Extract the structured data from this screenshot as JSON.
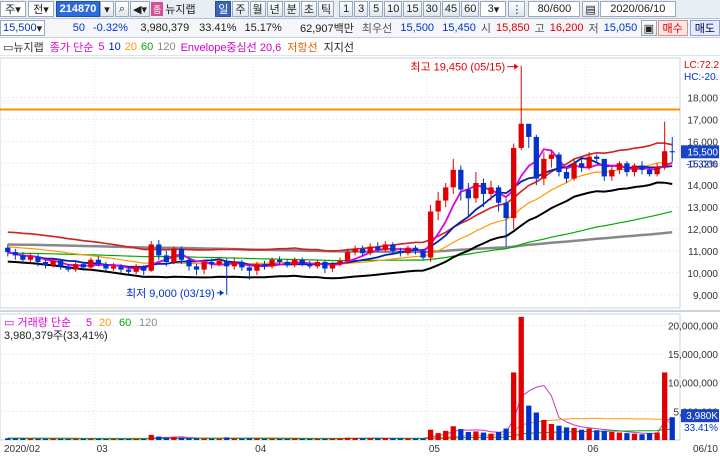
{
  "toolbar": {
    "menu1": "주",
    "menu2": "전",
    "stock_code": "214870",
    "news_label": "뉴지랩",
    "periods": [
      "일",
      "주",
      "월",
      "년",
      "분",
      "초",
      "틱"
    ],
    "selected_period": "일",
    "intervals": [
      "1",
      "3",
      "5",
      "10",
      "15",
      "30",
      "45",
      "60"
    ],
    "interval_value": "3",
    "count": "80/600",
    "date": "2020/06/10"
  },
  "quote": {
    "price": "15,500",
    "change": "50",
    "change_rate": "-0.32%",
    "volume": "3,980,379",
    "turnover_rate": "33.41%",
    "rate2": "15.17%",
    "amount": "62,907백만",
    "best_ask_label": "최우선",
    "best_ask": "15,500",
    "best_bid": "15,450",
    "open_label": "시",
    "open": "15,850",
    "high_label": "고",
    "high": "16,200",
    "low_label": "저",
    "low": "15,050",
    "buy_label": "매수",
    "sell_label": "매도"
  },
  "indicators": {
    "stock_name": "뉴지랩",
    "ma_label": "종가 단순",
    "ma_periods": [
      "5",
      "10",
      "20",
      "60",
      "120"
    ],
    "envelope": "Envelope중심선 20,6",
    "resistance": "저항선",
    "support": "지지선"
  },
  "colors": {
    "up": "#e00000",
    "down": "#0033cc",
    "ma5": "#e000e0",
    "ma10": "#0022aa",
    "ma20": "#ff9900",
    "ma60": "#00aa00",
    "ma120": "#888888",
    "resistance": "#ff8c00"
  },
  "chart_data": {
    "type": "candlestick",
    "price_axis": {
      "ticks": [
        9000,
        10000,
        11000,
        12000,
        13000,
        14000,
        15000,
        16000,
        17000,
        18000
      ],
      "tick_labels": [
        "9,000",
        "10,000",
        "11,000",
        "12,000",
        "13,000",
        "14,000",
        "15,000",
        "16,000",
        "17,000",
        "18,000"
      ],
      "range": [
        8400,
        19800
      ],
      "current": "15,500",
      "current_change": "-0.32%",
      "lc_label": "LC:72.2",
      "hc_label": "HC:-20."
    },
    "annotations": {
      "high": "최고 19,450 (05/15)",
      "low": "최저 9,000 (03/19)"
    },
    "resistance_level": 17450,
    "date_labels": [
      "2020/02",
      "03",
      "04",
      "05",
      "06",
      "06/10"
    ],
    "volume_panel": {
      "title": "거래량 단순",
      "ma_periods": [
        "5",
        "20",
        "60",
        "120"
      ],
      "current_text": "3,980,379주(33,41%)",
      "ticks": [
        5000000,
        10000000,
        15000000,
        20000000
      ],
      "tick_labels": [
        "5,000,000",
        "10,000,000",
        "15,000,000",
        "20,000,000"
      ],
      "range": [
        0,
        22000000
      ],
      "current_label": "3,980K",
      "current_pct": "33.41%"
    },
    "candles": [
      {
        "o": 11150,
        "c": 10950,
        "h": 11300,
        "l": 10750,
        "v": 300000
      },
      {
        "o": 10950,
        "c": 10800,
        "h": 11100,
        "l": 10600,
        "v": 280000
      },
      {
        "o": 10800,
        "c": 10600,
        "h": 10950,
        "l": 10400,
        "v": 260000
      },
      {
        "o": 10600,
        "c": 10750,
        "h": 10900,
        "l": 10450,
        "v": 240000
      },
      {
        "o": 10750,
        "c": 10500,
        "h": 10850,
        "l": 10300,
        "v": 230000
      },
      {
        "o": 10500,
        "c": 10350,
        "h": 10600,
        "l": 10200,
        "v": 220000
      },
      {
        "o": 10350,
        "c": 10550,
        "h": 10700,
        "l": 10250,
        "v": 240000
      },
      {
        "o": 10550,
        "c": 10300,
        "h": 10650,
        "l": 10150,
        "v": 210000
      },
      {
        "o": 10300,
        "c": 10150,
        "h": 10400,
        "l": 10050,
        "v": 200000
      },
      {
        "o": 10150,
        "c": 10400,
        "h": 10500,
        "l": 10050,
        "v": 210000
      },
      {
        "o": 10400,
        "c": 10250,
        "h": 10500,
        "l": 10100,
        "v": 190000
      },
      {
        "o": 10250,
        "c": 10600,
        "h": 10700,
        "l": 10150,
        "v": 230000
      },
      {
        "o": 10600,
        "c": 10400,
        "h": 10750,
        "l": 10300,
        "v": 200000
      },
      {
        "o": 10400,
        "c": 10200,
        "h": 10500,
        "l": 10100,
        "v": 180000
      },
      {
        "o": 10200,
        "c": 10300,
        "h": 10450,
        "l": 10100,
        "v": 170000
      },
      {
        "o": 10300,
        "c": 10150,
        "h": 10400,
        "l": 10000,
        "v": 180000
      },
      {
        "o": 10150,
        "c": 10050,
        "h": 10250,
        "l": 9950,
        "v": 170000
      },
      {
        "o": 10050,
        "c": 10300,
        "h": 10400,
        "l": 9950,
        "v": 190000
      },
      {
        "o": 10300,
        "c": 10100,
        "h": 10350,
        "l": 9900,
        "v": 180000
      },
      {
        "o": 10100,
        "c": 11300,
        "h": 11450,
        "l": 10050,
        "v": 900000
      },
      {
        "o": 11300,
        "c": 10800,
        "h": 11500,
        "l": 10600,
        "v": 600000
      },
      {
        "o": 10800,
        "c": 10500,
        "h": 11000,
        "l": 10300,
        "v": 380000
      },
      {
        "o": 10500,
        "c": 11100,
        "h": 11200,
        "l": 10400,
        "v": 500000
      },
      {
        "o": 11100,
        "c": 10600,
        "h": 11200,
        "l": 10400,
        "v": 400000
      },
      {
        "o": 10600,
        "c": 10300,
        "h": 10700,
        "l": 10100,
        "v": 300000
      },
      {
        "o": 10300,
        "c": 10150,
        "h": 10400,
        "l": 9900,
        "v": 280000
      },
      {
        "o": 10150,
        "c": 10500,
        "h": 10600,
        "l": 9950,
        "v": 250000
      },
      {
        "o": 10500,
        "c": 10400,
        "h": 10650,
        "l": 10200,
        "v": 230000
      },
      {
        "o": 10400,
        "c": 10550,
        "h": 10700,
        "l": 10300,
        "v": 220000
      },
      {
        "o": 10550,
        "c": 10300,
        "h": 10650,
        "l": 9000,
        "v": 450000
      },
      {
        "o": 10300,
        "c": 10500,
        "h": 10700,
        "l": 10150,
        "v": 260000
      },
      {
        "o": 10500,
        "c": 10250,
        "h": 10600,
        "l": 10100,
        "v": 240000
      },
      {
        "o": 10250,
        "c": 10100,
        "h": 10300,
        "l": 9700,
        "v": 300000
      },
      {
        "o": 10100,
        "c": 10400,
        "h": 10500,
        "l": 9900,
        "v": 280000
      },
      {
        "o": 10400,
        "c": 10300,
        "h": 10550,
        "l": 10150,
        "v": 220000
      },
      {
        "o": 10300,
        "c": 10600,
        "h": 10700,
        "l": 10200,
        "v": 240000
      },
      {
        "o": 10600,
        "c": 10500,
        "h": 10750,
        "l": 10350,
        "v": 210000
      },
      {
        "o": 10500,
        "c": 10350,
        "h": 10600,
        "l": 10250,
        "v": 200000
      },
      {
        "o": 10350,
        "c": 10600,
        "h": 10700,
        "l": 10250,
        "v": 220000
      },
      {
        "o": 10600,
        "c": 10400,
        "h": 10700,
        "l": 10300,
        "v": 200000
      },
      {
        "o": 10400,
        "c": 10300,
        "h": 10550,
        "l": 10200,
        "v": 190000
      },
      {
        "o": 10300,
        "c": 10500,
        "h": 10600,
        "l": 10200,
        "v": 200000
      },
      {
        "o": 10500,
        "c": 10200,
        "h": 10600,
        "l": 10000,
        "v": 220000
      },
      {
        "o": 10200,
        "c": 10400,
        "h": 10500,
        "l": 10050,
        "v": 230000
      },
      {
        "o": 10400,
        "c": 10550,
        "h": 10700,
        "l": 10300,
        "v": 250000
      },
      {
        "o": 10550,
        "c": 10950,
        "h": 11100,
        "l": 10450,
        "v": 400000
      },
      {
        "o": 10950,
        "c": 11100,
        "h": 11250,
        "l": 10800,
        "v": 350000
      },
      {
        "o": 11100,
        "c": 10900,
        "h": 11250,
        "l": 10750,
        "v": 300000
      },
      {
        "o": 10900,
        "c": 11200,
        "h": 11350,
        "l": 10800,
        "v": 320000
      },
      {
        "o": 11200,
        "c": 11050,
        "h": 11400,
        "l": 10950,
        "v": 290000
      },
      {
        "o": 11050,
        "c": 11300,
        "h": 11450,
        "l": 10950,
        "v": 330000
      },
      {
        "o": 11300,
        "c": 11000,
        "h": 11400,
        "l": 10850,
        "v": 280000
      },
      {
        "o": 11000,
        "c": 10900,
        "h": 11150,
        "l": 10750,
        "v": 260000
      },
      {
        "o": 10900,
        "c": 11150,
        "h": 11250,
        "l": 10800,
        "v": 270000
      },
      {
        "o": 11150,
        "c": 11000,
        "h": 11250,
        "l": 10850,
        "v": 250000
      },
      {
        "o": 11000,
        "c": 10700,
        "h": 11100,
        "l": 10600,
        "v": 260000
      },
      {
        "o": 10700,
        "c": 12800,
        "h": 13100,
        "l": 10500,
        "v": 1800000
      },
      {
        "o": 12800,
        "c": 13300,
        "h": 13700,
        "l": 12400,
        "v": 1200000
      },
      {
        "o": 13300,
        "c": 13900,
        "h": 14100,
        "l": 13000,
        "v": 1600000
      },
      {
        "o": 13900,
        "c": 14700,
        "h": 15200,
        "l": 13600,
        "v": 2400000
      },
      {
        "o": 14700,
        "c": 13800,
        "h": 14900,
        "l": 13300,
        "v": 1900000
      },
      {
        "o": 13800,
        "c": 13400,
        "h": 14100,
        "l": 12600,
        "v": 1400000
      },
      {
        "o": 13400,
        "c": 14100,
        "h": 14600,
        "l": 13200,
        "v": 1500000
      },
      {
        "o": 14100,
        "c": 13600,
        "h": 14300,
        "l": 13000,
        "v": 1300000
      },
      {
        "o": 13600,
        "c": 13900,
        "h": 14200,
        "l": 13300,
        "v": 1100000
      },
      {
        "o": 13900,
        "c": 13200,
        "h": 14000,
        "l": 12800,
        "v": 1400000
      },
      {
        "o": 13200,
        "c": 12500,
        "h": 13400,
        "l": 11200,
        "v": 2000000
      },
      {
        "o": 12500,
        "c": 15700,
        "h": 15900,
        "l": 12000,
        "v": 11800000
      },
      {
        "o": 15700,
        "c": 16800,
        "h": 19450,
        "l": 15600,
        "v": 21500000
      },
      {
        "o": 16800,
        "c": 16200,
        "h": 16500,
        "l": 15700,
        "v": 6000000
      },
      {
        "o": 16200,
        "c": 14300,
        "h": 16300,
        "l": 14000,
        "v": 4800000
      },
      {
        "o": 14300,
        "c": 15200,
        "h": 15500,
        "l": 14000,
        "v": 3500000
      },
      {
        "o": 15200,
        "c": 15400,
        "h": 15600,
        "l": 14800,
        "v": 2800000
      },
      {
        "o": 15400,
        "c": 14600,
        "h": 15500,
        "l": 14400,
        "v": 2500000
      },
      {
        "o": 14600,
        "c": 14300,
        "h": 14800,
        "l": 14100,
        "v": 2200000
      },
      {
        "o": 14300,
        "c": 15000,
        "h": 15200,
        "l": 14200,
        "v": 2100000
      },
      {
        "o": 15000,
        "c": 14800,
        "h": 15200,
        "l": 14600,
        "v": 1800000
      },
      {
        "o": 14800,
        "c": 15300,
        "h": 15500,
        "l": 14700,
        "v": 2000000
      },
      {
        "o": 15300,
        "c": 15200,
        "h": 15400,
        "l": 15000,
        "v": 1700000
      },
      {
        "o": 15200,
        "c": 14400,
        "h": 15200,
        "l": 14200,
        "v": 1600000
      },
      {
        "o": 14400,
        "c": 14700,
        "h": 14900,
        "l": 14200,
        "v": 1400000
      },
      {
        "o": 14700,
        "c": 15000,
        "h": 15100,
        "l": 14500,
        "v": 1300000
      },
      {
        "o": 15000,
        "c": 14600,
        "h": 15100,
        "l": 14400,
        "v": 1200000
      },
      {
        "o": 14600,
        "c": 14900,
        "h": 15000,
        "l": 14400,
        "v": 1100000
      },
      {
        "o": 14900,
        "c": 14700,
        "h": 15100,
        "l": 14500,
        "v": 1000000
      },
      {
        "o": 14700,
        "c": 14500,
        "h": 14800,
        "l": 14400,
        "v": 1200000
      },
      {
        "o": 14500,
        "c": 14850,
        "h": 15000,
        "l": 14400,
        "v": 1300000
      },
      {
        "o": 14850,
        "c": 15550,
        "h": 16900,
        "l": 14700,
        "v": 11800000
      },
      {
        "o": 15550,
        "c": 15500,
        "h": 16200,
        "l": 15050,
        "v": 3980379
      }
    ]
  }
}
